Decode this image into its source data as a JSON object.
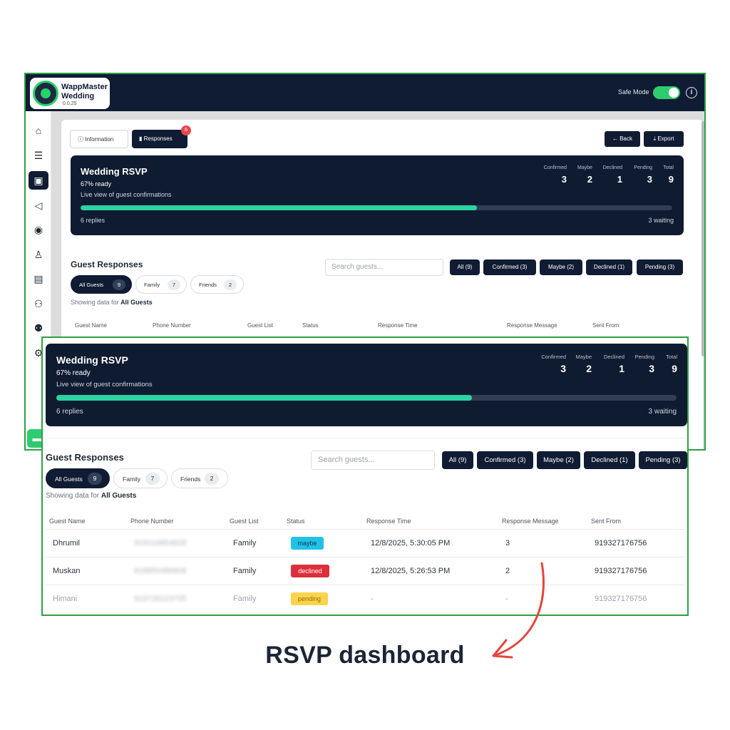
{
  "app": {
    "name_line1": "WappMaster",
    "name_line2": "Wedding",
    "version": "0.0.25",
    "safe_mode_label": "Safe Mode",
    "safe_mode_on": true
  },
  "sidebar": {
    "icons": [
      "home-icon",
      "list-icon",
      "rsvp-icon",
      "megaphone-icon",
      "bot-icon",
      "user-icon",
      "document-icon",
      "users-icon",
      "group-icon",
      "gear-icon"
    ],
    "active": "rsvp-icon"
  },
  "tabs": {
    "information": "Information",
    "responses": "Responses",
    "responses_badge": "6"
  },
  "actions": {
    "back": "← Back",
    "export": "Export"
  },
  "hero": {
    "title": "Wedding RSVP",
    "ready": "67% ready",
    "subtitle": "Live view of guest confirmations",
    "progress": 0.67,
    "replies": "6 replies",
    "waiting": "3 waiting",
    "stats": [
      {
        "label": "Confirmed",
        "value": "3"
      },
      {
        "label": "Maybe",
        "value": "2"
      },
      {
        "label": "Declined",
        "value": "1"
      },
      {
        "label": "Pending",
        "value": "3"
      },
      {
        "label": "Total",
        "value": "9"
      }
    ]
  },
  "responses": {
    "heading": "Guest Responses",
    "search_placeholder": "Search guests...",
    "filters": [
      "All (9)",
      "Confirmed (3)",
      "Maybe (2)",
      "Declined (1)",
      "Pending (3)"
    ],
    "groups": [
      {
        "label": "All Guests",
        "count": "9"
      },
      {
        "label": "Family",
        "count": "7"
      },
      {
        "label": "Friends",
        "count": "2"
      }
    ],
    "showing_prefix": "Showing data for",
    "showing_value": "All Guests",
    "columns": [
      "Guest Name",
      "Phone Number",
      "Guest List",
      "Status",
      "Response Time",
      "Response Message",
      "Sent From"
    ],
    "rows": [
      {
        "name": "Dhrumil",
        "phone": "919104854828",
        "list": "Family",
        "status": "maybe",
        "time": "12/8/2025, 5:30:05 PM",
        "message": "3",
        "sent_from": "919327176756"
      },
      {
        "name": "Muskan",
        "phone": "918850486808",
        "list": "Family",
        "status": "declined",
        "time": "12/8/2025, 5:26:53 PM",
        "message": "2",
        "sent_from": "919327176756"
      },
      {
        "name": "Himani",
        "phone": "919726123705",
        "list": "Family",
        "status": "pending",
        "time": "-",
        "message": "-",
        "sent_from": "919327176756"
      }
    ],
    "status_colors": {
      "maybe": "#22c1e8",
      "declined": "#dc2f3c",
      "pending": "#fcd34d"
    }
  },
  "caption": "RSVP dashboard",
  "colors": {
    "navy": "#101c33",
    "accent": "#2bd4a0",
    "frame": "#2ea043",
    "arrow": "#e2463a"
  }
}
